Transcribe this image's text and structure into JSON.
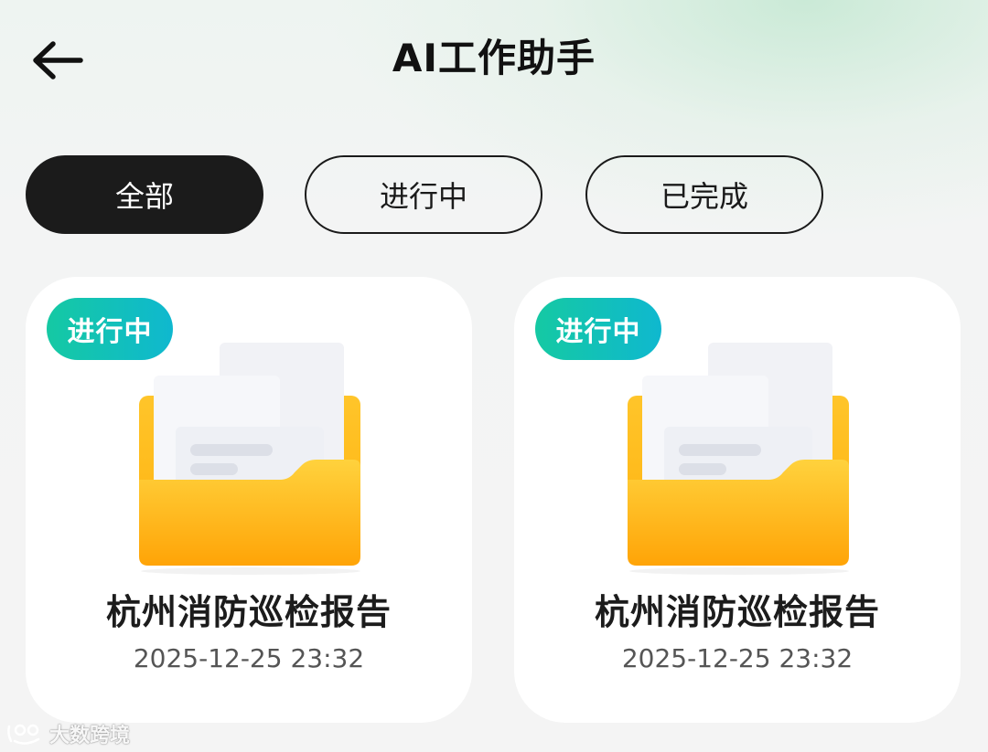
{
  "header": {
    "title": "AI工作助手",
    "back_icon": "arrow-left-icon"
  },
  "filters": {
    "items": [
      {
        "label": "全部",
        "active": true
      },
      {
        "label": "进行中",
        "active": false
      },
      {
        "label": "已完成",
        "active": false
      }
    ]
  },
  "cards": [
    {
      "status": "进行中",
      "title": "杭州消防巡检报告",
      "time": "2025-12-25 23:32",
      "icon": "folder-documents-icon"
    },
    {
      "status": "进行中",
      "title": "杭州消防巡检报告",
      "time": "2025-12-25 23:32",
      "icon": "folder-documents-icon"
    }
  ],
  "watermark": {
    "text": "大数跨境"
  },
  "colors": {
    "badge_start": "#15c9a3",
    "badge_end": "#0fb8cf",
    "active_pill": "#1b1b1b",
    "folder_yellow": "#ffc21a",
    "folder_orange": "#ffa60a"
  }
}
